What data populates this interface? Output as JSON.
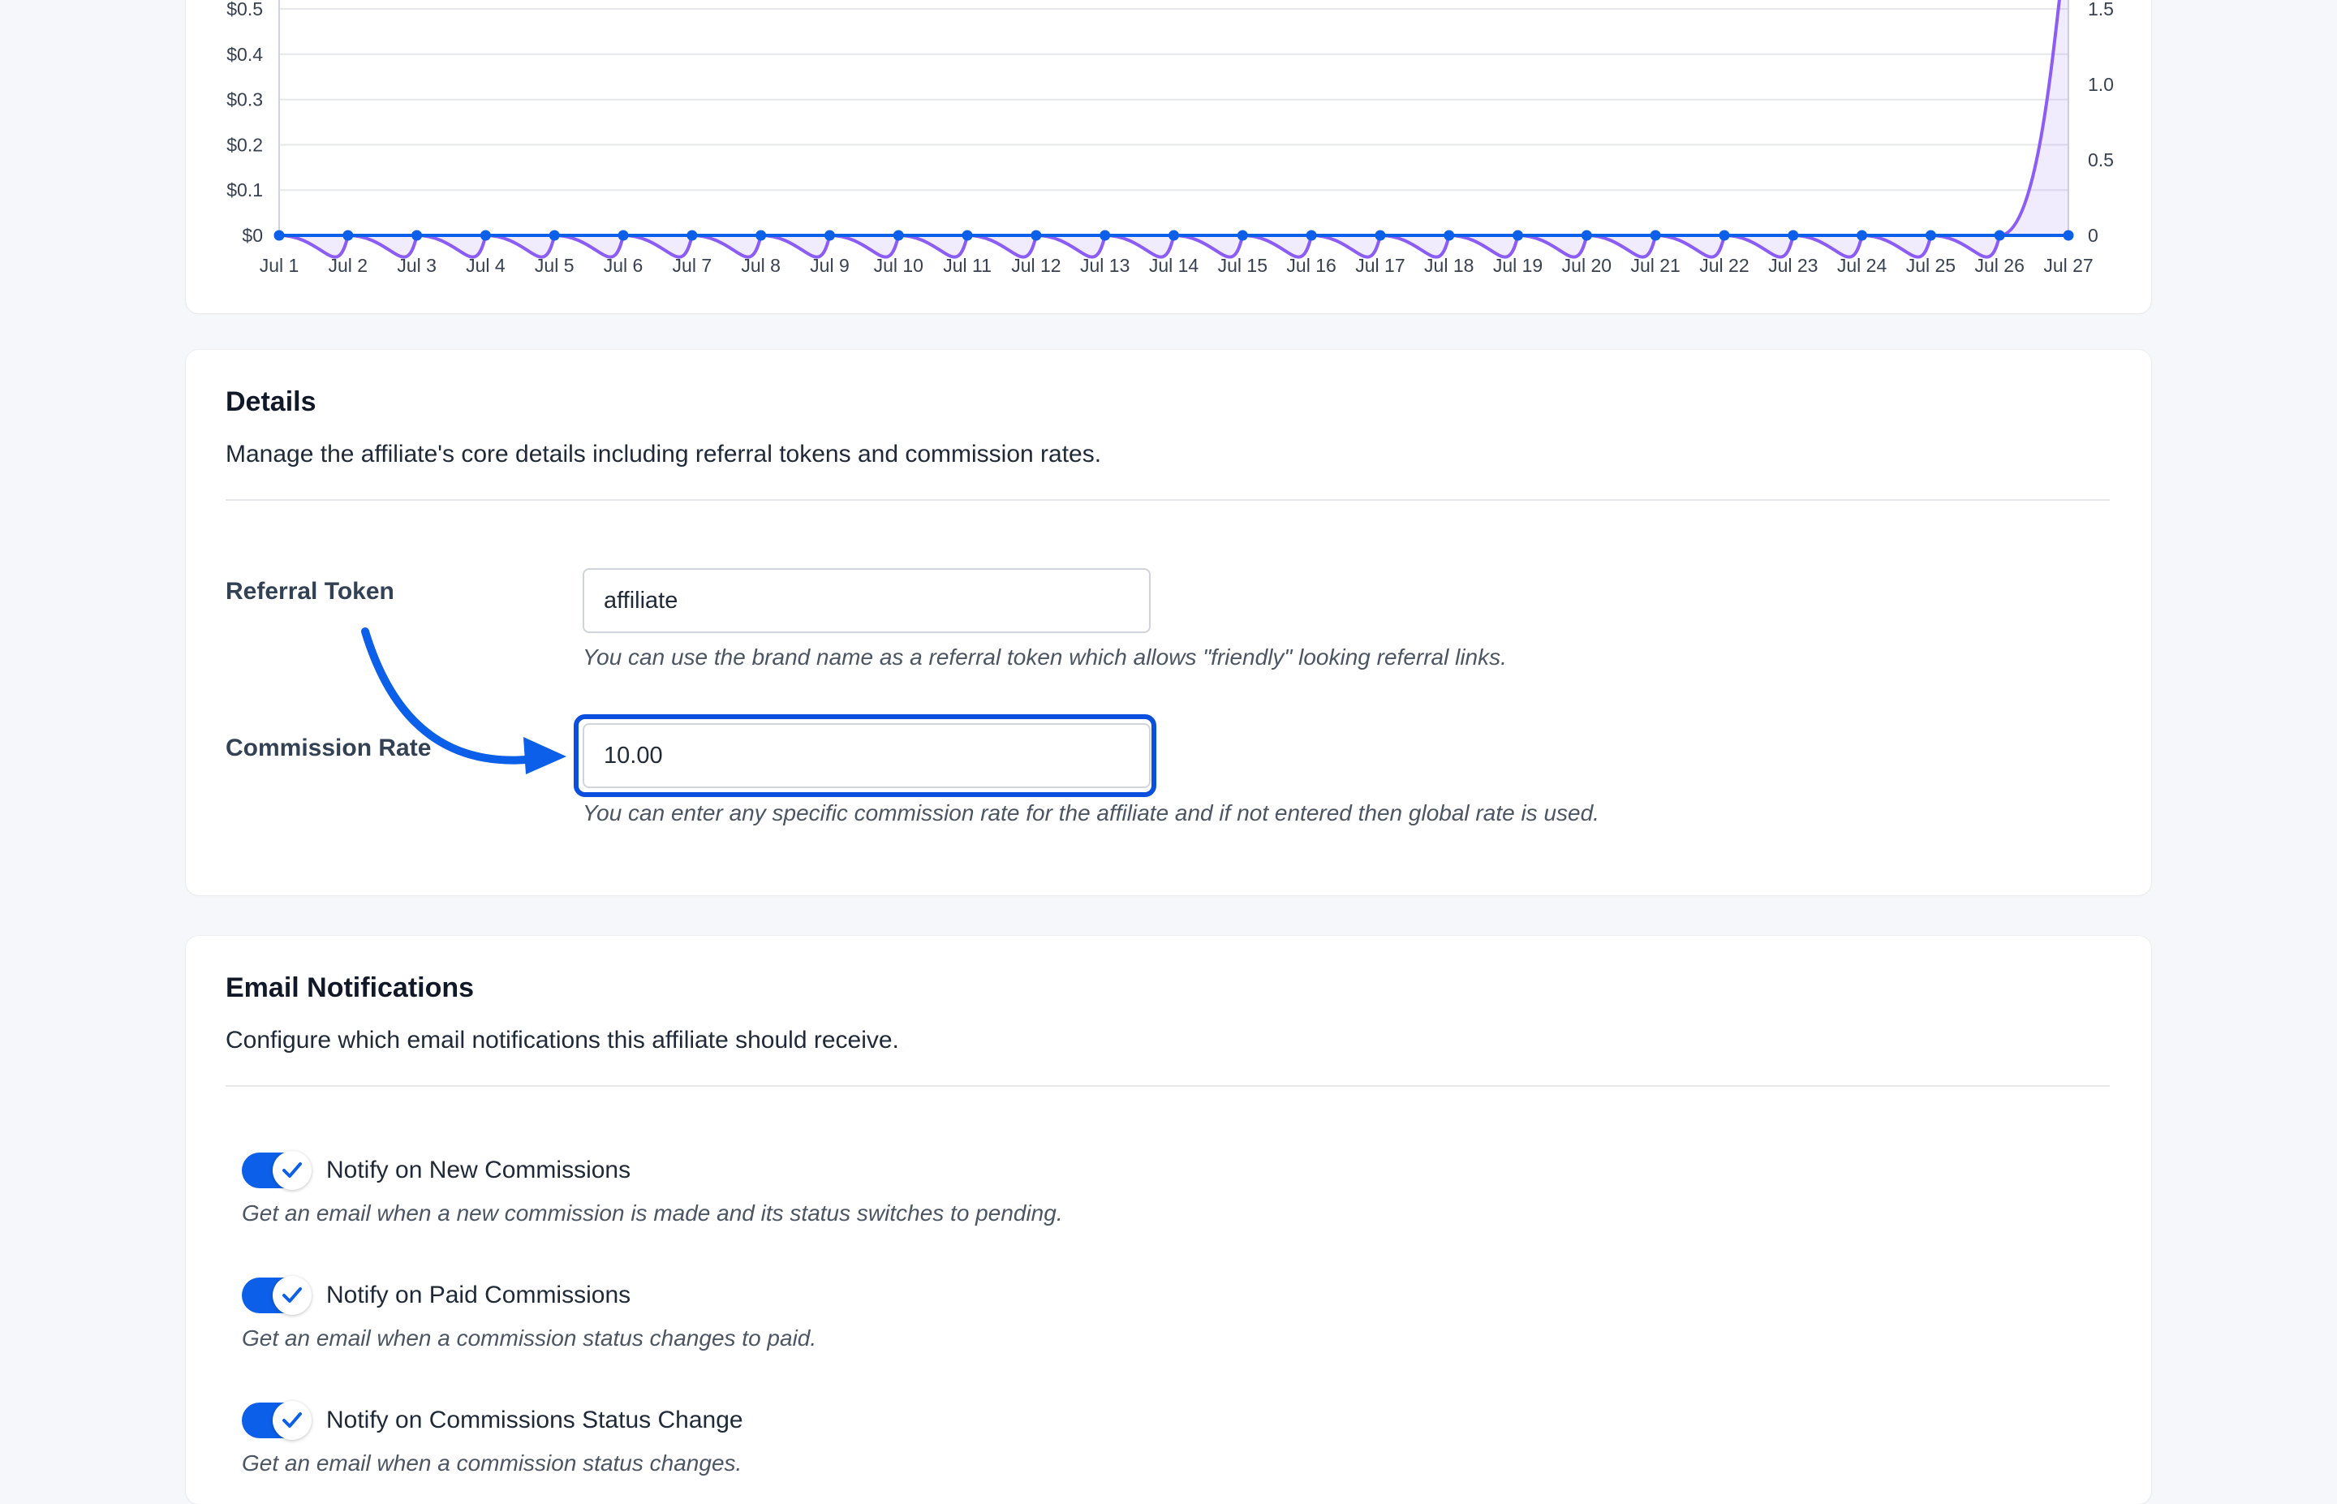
{
  "colors": {
    "accent": "#0b5fe8",
    "series_earnings": "#0b5fe8",
    "series_secondary": "#8b5cf6",
    "highlight_ring": "#0b4fde"
  },
  "chart_data": {
    "type": "line",
    "x": [
      "Jul 1",
      "Jul 2",
      "Jul 3",
      "Jul 4",
      "Jul 5",
      "Jul 6",
      "Jul 7",
      "Jul 8",
      "Jul 9",
      "Jul 10",
      "Jul 11",
      "Jul 12",
      "Jul 13",
      "Jul 14",
      "Jul 15",
      "Jul 16",
      "Jul 17",
      "Jul 18",
      "Jul 19",
      "Jul 20",
      "Jul 21",
      "Jul 22",
      "Jul 23",
      "Jul 24",
      "Jul 25",
      "Jul 26",
      "Jul 27"
    ],
    "y_left_ticks": [
      "$0",
      "$0.1",
      "$0.2",
      "$0.3",
      "$0.4",
      "$0.5"
    ],
    "y_left_range": [
      0,
      0.5
    ],
    "y_right_ticks": [
      "0",
      "0.5",
      "1.0",
      "1.5"
    ],
    "y_right_range": [
      0,
      1.5
    ],
    "grid": true,
    "series": [
      {
        "axis": "left",
        "color": "#0b5fe8",
        "markers": true,
        "values": [
          0,
          0,
          0,
          0,
          0,
          0,
          0,
          0,
          0,
          0,
          0,
          0,
          0,
          0,
          0,
          0,
          0,
          0,
          0,
          0,
          0,
          0,
          0,
          0,
          0,
          0,
          0
        ]
      },
      {
        "axis": "right",
        "color": "#8b5cf6",
        "fill": true,
        "markers": false,
        "values": [
          0,
          0,
          0,
          0,
          0,
          0,
          0,
          0,
          0,
          0,
          0,
          0,
          0,
          0,
          0,
          0,
          0,
          0,
          0,
          0,
          0,
          0,
          0,
          0,
          0,
          0,
          2
        ]
      }
    ]
  },
  "details": {
    "title": "Details",
    "description": "Manage the affiliate's core details including referral tokens and commission rates.",
    "referral_token": {
      "label": "Referral Token",
      "value": "affiliate",
      "help": "You can use the brand name as a referral token which allows \"friendly\" looking referral links."
    },
    "commission_rate": {
      "label": "Commission Rate",
      "value": "10.00",
      "help": "You can enter any specific commission rate for the affiliate and if not entered then global rate is used."
    }
  },
  "email_notifications": {
    "title": "Email Notifications",
    "description": "Configure which email notifications this affiliate should receive.",
    "items": [
      {
        "label": "Notify on New Commissions",
        "description": "Get an email when a new commission is made and its status switches to pending.",
        "enabled": true
      },
      {
        "label": "Notify on Paid Commissions",
        "description": "Get an email when a commission status changes to paid.",
        "enabled": true
      },
      {
        "label": "Notify on Commissions Status Change",
        "description": "Get an email when a commission status changes.",
        "enabled": true
      }
    ]
  }
}
